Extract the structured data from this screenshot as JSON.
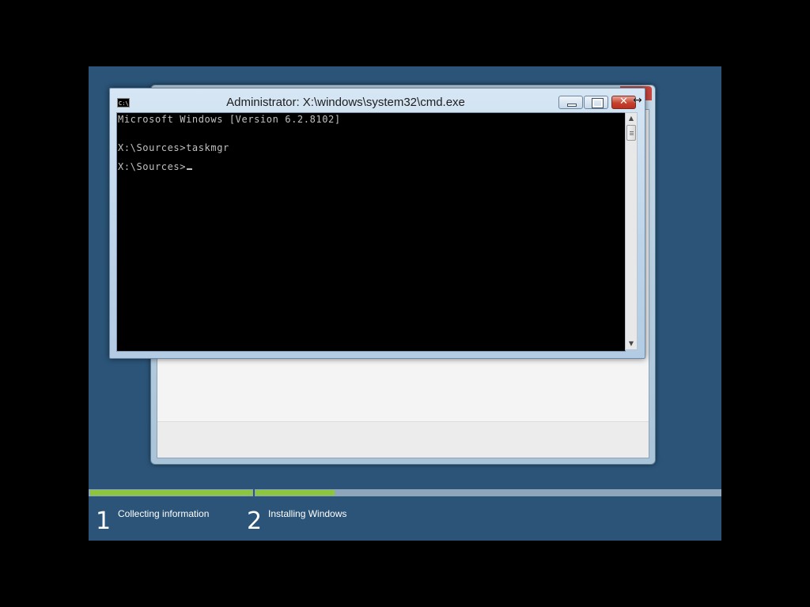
{
  "cmd_window": {
    "title": "Administrator: X:\\windows\\system32\\cmd.exe",
    "icon_text": "C:\\",
    "minimize_symbol": "",
    "maximize_symbol": "",
    "close_symbol": "✕",
    "lines": [
      "Microsoft Windows [Version 6.2.8102]",
      "X:\\Sources>taskmgr",
      "X:\\Sources>"
    ],
    "scroll_up_symbol": "▲",
    "scroll_down_symbol": "▼"
  },
  "setup_progress": {
    "steps": [
      {
        "number": "1",
        "label": "Collecting information"
      },
      {
        "number": "2",
        "label": "Installing Windows"
      }
    ],
    "step1_progress": 1.0,
    "step2_progress": 0.17,
    "accent_color": "#8cc63f",
    "background_color": "#2b5478"
  },
  "cursor_icon": "resize-horizontal-cursor-icon"
}
